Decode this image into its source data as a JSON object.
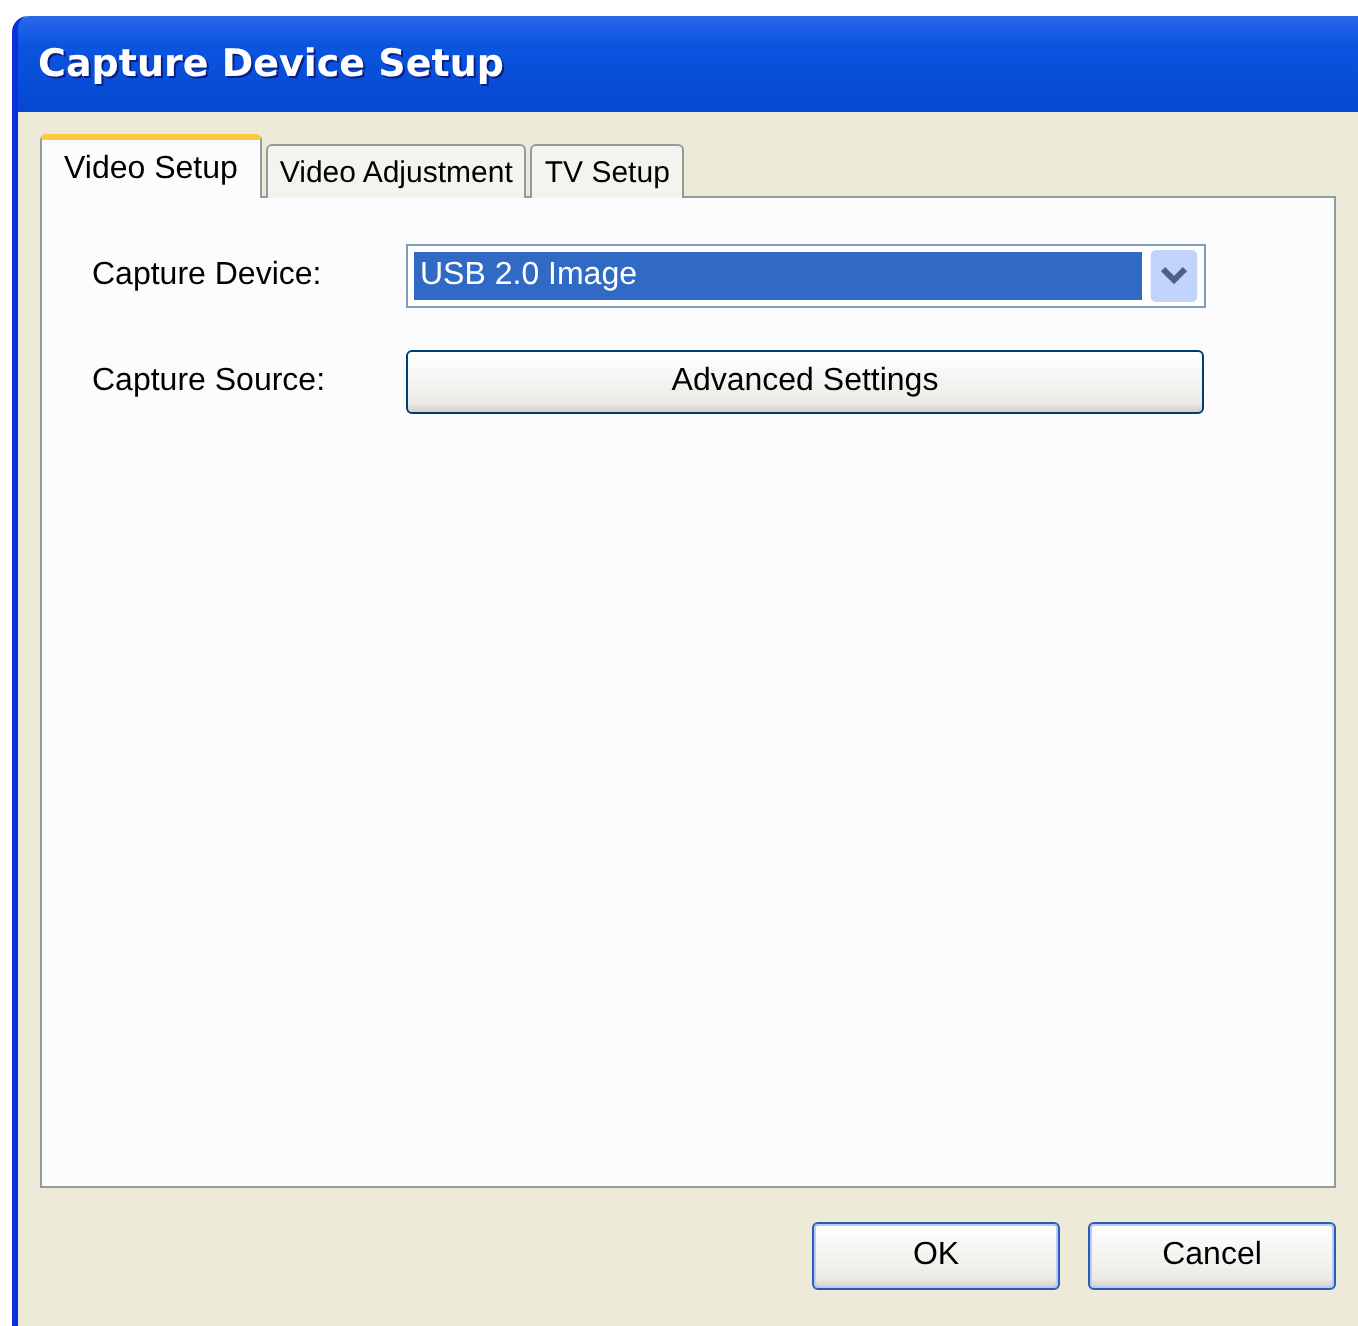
{
  "window": {
    "title": "Capture Device Setup"
  },
  "tabs": [
    {
      "label": "Video Setup",
      "selected": true
    },
    {
      "label": "Video Adjustment",
      "selected": false
    },
    {
      "label": "TV Setup",
      "selected": false
    }
  ],
  "fields": [
    {
      "kind": "dropdown",
      "label": "Capture Device:",
      "value": "USB 2.0 Image"
    },
    {
      "kind": "button",
      "label": "Capture Source:",
      "value": "Advanced Settings"
    }
  ],
  "buttons": [
    "OK",
    "Cancel"
  ]
}
